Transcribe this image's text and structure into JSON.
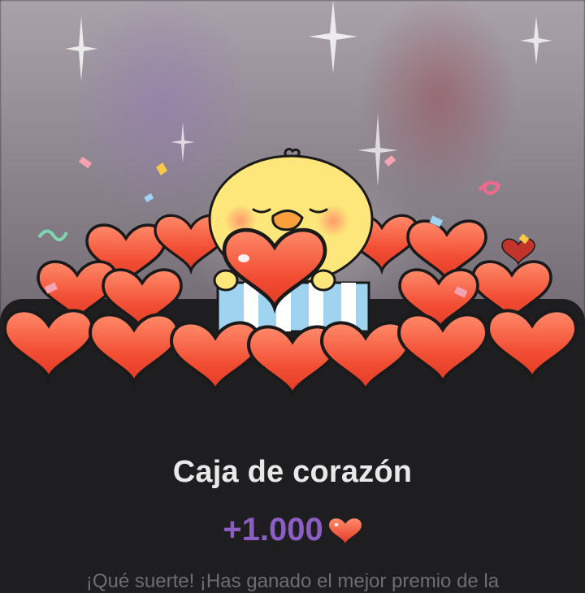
{
  "reward_card": {
    "title": "Caja de corazón",
    "amount": "+1.000",
    "message": "¡Qué suerte! ¡Has ganado el mejor premio de la",
    "accent_color": "#8c5ec4",
    "heart_color": "#f05a3c",
    "icons": [
      "heart-icon",
      "chick-mascot",
      "gift-box",
      "confetti",
      "sparkle"
    ]
  }
}
